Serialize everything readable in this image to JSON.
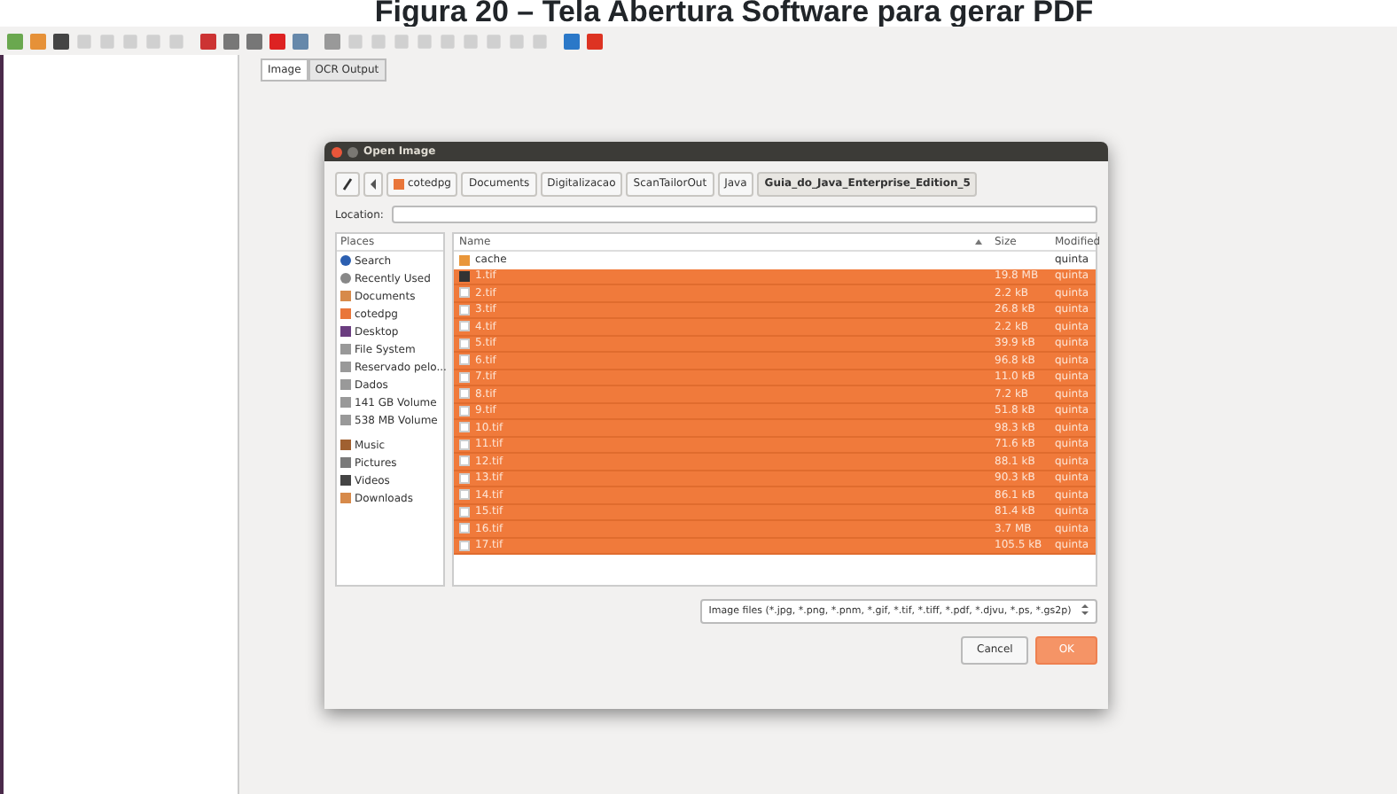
{
  "caption": "Figura 20 – Tela Abertura Software para gerar PDF",
  "toolbar": [
    {
      "color": "#6aa84f",
      "disabled": false
    },
    {
      "color": "#e69138",
      "disabled": false
    },
    {
      "color": "#444444",
      "disabled": false
    },
    {
      "color": "#d0d0d0",
      "disabled": true
    },
    {
      "color": "#d0d0d0",
      "disabled": true
    },
    {
      "color": "#d0d0d0",
      "disabled": true
    },
    {
      "color": "#d0d0d0",
      "disabled": true
    },
    {
      "color": "#d0d0d0",
      "disabled": true
    },
    {
      "color": "#cc3333",
      "disabled": false
    },
    {
      "color": "#777777",
      "disabled": false
    },
    {
      "color": "#777777",
      "disabled": false
    },
    {
      "color": "#dd2222",
      "disabled": false
    },
    {
      "color": "#6688aa",
      "disabled": false
    },
    {
      "color": "#999999",
      "disabled": false
    },
    {
      "color": "#d0d0d0",
      "disabled": true
    },
    {
      "color": "#d0d0d0",
      "disabled": true
    },
    {
      "color": "#d0d0d0",
      "disabled": true
    },
    {
      "color": "#d0d0d0",
      "disabled": true
    },
    {
      "color": "#d0d0d0",
      "disabled": true
    },
    {
      "color": "#d0d0d0",
      "disabled": true
    },
    {
      "color": "#d0d0d0",
      "disabled": true
    },
    {
      "color": "#d0d0d0",
      "disabled": true
    },
    {
      "color": "#d0d0d0",
      "disabled": true
    },
    {
      "color": "#2b78c8",
      "disabled": false
    },
    {
      "color": "#dd3322",
      "disabled": false
    }
  ],
  "tabs": [
    {
      "label": "Image",
      "selected": true
    },
    {
      "label": "OCR Output",
      "selected": false
    }
  ],
  "dialog": {
    "title": "Open Image",
    "path": [
      {
        "label": "cotedpg",
        "selected": false,
        "home": true
      },
      {
        "label": "Documents",
        "selected": false,
        "home": false
      },
      {
        "label": "Digitalizacao",
        "selected": false,
        "home": false
      },
      {
        "label": "ScanTailorOut",
        "selected": false,
        "home": false
      },
      {
        "label": "Java",
        "selected": false,
        "home": false
      },
      {
        "label": "Guia_do_Java_Enterprise_Edition_5",
        "selected": true,
        "home": false
      }
    ],
    "location_label": "Location:",
    "places_header": "Places",
    "places": [
      {
        "kind": "search",
        "label": "Search"
      },
      {
        "kind": "recent",
        "label": "Recently Used"
      },
      {
        "kind": "folder",
        "label": "Documents"
      },
      {
        "kind": "home",
        "label": "cotedpg"
      },
      {
        "kind": "desktop",
        "label": "Desktop"
      },
      {
        "kind": "drive",
        "label": "File System"
      },
      {
        "kind": "drive",
        "label": "Reservado pelo..."
      },
      {
        "kind": "drive",
        "label": "Dados"
      },
      {
        "kind": "drive",
        "label": "141 GB Volume"
      },
      {
        "kind": "drive",
        "label": "538 MB Volume"
      },
      {
        "kind": "music",
        "label": "Music"
      },
      {
        "kind": "pictures",
        "label": "Pictures"
      },
      {
        "kind": "videos",
        "label": "Videos"
      },
      {
        "kind": "folder",
        "label": "Downloads"
      }
    ],
    "columns": [
      "Name",
      "Size",
      "Modified"
    ],
    "files": [
      {
        "kind": "folder",
        "name": "cache",
        "modified": "quinta",
        "selected": false
      },
      {
        "kind": "image",
        "name": "1.tif",
        "size": "19.8 MB",
        "modified": "quinta",
        "selected": true
      },
      {
        "kind": "file",
        "name": "2.tif",
        "size": "2.2 kB",
        "modified": "quinta",
        "selected": true
      },
      {
        "kind": "file",
        "name": "3.tif",
        "size": "26.8 kB",
        "modified": "quinta",
        "selected": true
      },
      {
        "kind": "file",
        "name": "4.tif",
        "size": "2.2 kB",
        "modified": "quinta",
        "selected": true
      },
      {
        "kind": "file",
        "name": "5.tif",
        "size": "39.9 kB",
        "modified": "quinta",
        "selected": true
      },
      {
        "kind": "file",
        "name": "6.tif",
        "size": "96.8 kB",
        "modified": "quinta",
        "selected": true
      },
      {
        "kind": "file",
        "name": "7.tif",
        "size": "11.0 kB",
        "modified": "quinta",
        "selected": true
      },
      {
        "kind": "file",
        "name": "8.tif",
        "size": "7.2 kB",
        "modified": "quinta",
        "selected": true
      },
      {
        "kind": "file",
        "name": "9.tif",
        "size": "51.8 kB",
        "modified": "quinta",
        "selected": true
      },
      {
        "kind": "file",
        "name": "10.tif",
        "size": "98.3 kB",
        "modified": "quinta",
        "selected": true
      },
      {
        "kind": "file",
        "name": "11.tif",
        "size": "71.6 kB",
        "modified": "quinta",
        "selected": true
      },
      {
        "kind": "file",
        "name": "12.tif",
        "size": "88.1 kB",
        "modified": "quinta",
        "selected": true
      },
      {
        "kind": "file",
        "name": "13.tif",
        "size": "90.3 kB",
        "modified": "quinta",
        "selected": true
      },
      {
        "kind": "file",
        "name": "14.tif",
        "size": "86.1 kB",
        "modified": "quinta",
        "selected": true
      },
      {
        "kind": "file",
        "name": "15.tif",
        "size": "81.4 kB",
        "modified": "quinta",
        "selected": true
      },
      {
        "kind": "file",
        "name": "16.tif",
        "size": "3.7 MB",
        "modified": "quinta",
        "selected": true
      },
      {
        "kind": "file",
        "name": "17.tif",
        "size": "105.5 kB",
        "modified": "quinta",
        "selected": true
      }
    ],
    "filter": "Image files (*.jpg, *.png, *.pnm, *.gif, *.tif, *.tiff, *.pdf, *.djvu, *.ps, *.gs2p)",
    "buttons": [
      {
        "label": "Cancel",
        "kind": "secondary"
      },
      {
        "label": "OK",
        "kind": "primary"
      }
    ]
  }
}
